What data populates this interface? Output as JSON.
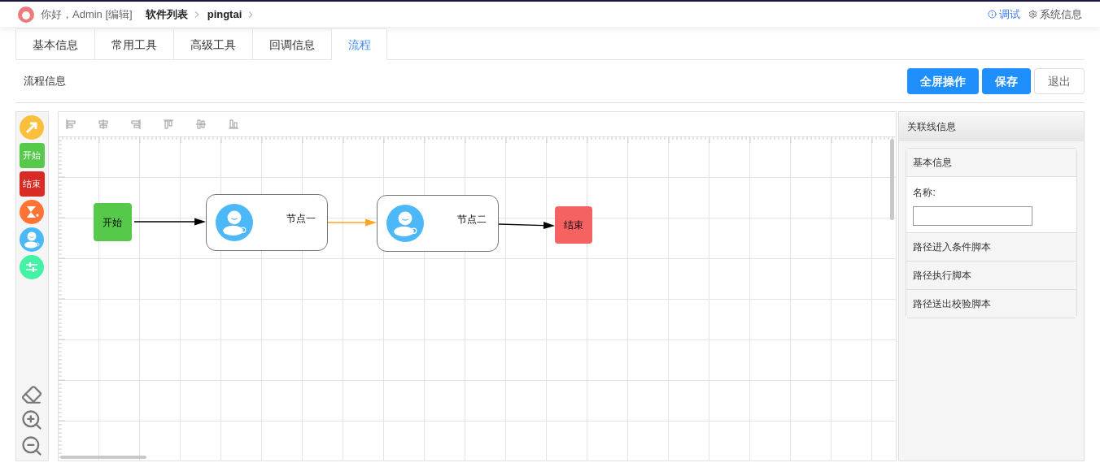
{
  "header": {
    "greeting": "你好，Admin [编辑]",
    "breadcrumbs": [
      "软件列表",
      "pingtai"
    ],
    "links": [
      {
        "kind": "info",
        "label": "调试"
      },
      {
        "kind": "settings",
        "label": "系统信息"
      }
    ]
  },
  "tabs": [
    {
      "label": "基本信息",
      "selected": false
    },
    {
      "label": "常用工具",
      "selected": false
    },
    {
      "label": "高级工具",
      "selected": false
    },
    {
      "label": "回调信息",
      "selected": false
    },
    {
      "label": "流程",
      "selected": true
    }
  ],
  "section": {
    "title": "流程信息",
    "buttons": [
      {
        "label": "全屏操作",
        "kind": "primary"
      },
      {
        "label": "保存",
        "kind": "primary"
      },
      {
        "label": "退出",
        "kind": "plain"
      }
    ]
  },
  "palette": [
    {
      "kind": "pointer"
    },
    {
      "kind": "start",
      "label": "开始"
    },
    {
      "kind": "end",
      "label": "结束"
    },
    {
      "kind": "timer"
    },
    {
      "kind": "user"
    },
    {
      "kind": "control"
    }
  ],
  "canvas": {
    "nodes": [
      {
        "kind": "start",
        "label": "开始"
      },
      {
        "kind": "task",
        "label": "节点一"
      },
      {
        "kind": "task",
        "label": "节点二"
      },
      {
        "kind": "end",
        "label": "结束"
      }
    ],
    "edges": [
      {
        "selected": false
      },
      {
        "selected": true
      },
      {
        "selected": false
      }
    ]
  },
  "panel": {
    "title": "关联线信息",
    "section": "基本信息",
    "field_label": "名称:",
    "rows": [
      "路径进入条件脚本",
      "路径执行脚本",
      "路径送出校验脚本"
    ]
  }
}
